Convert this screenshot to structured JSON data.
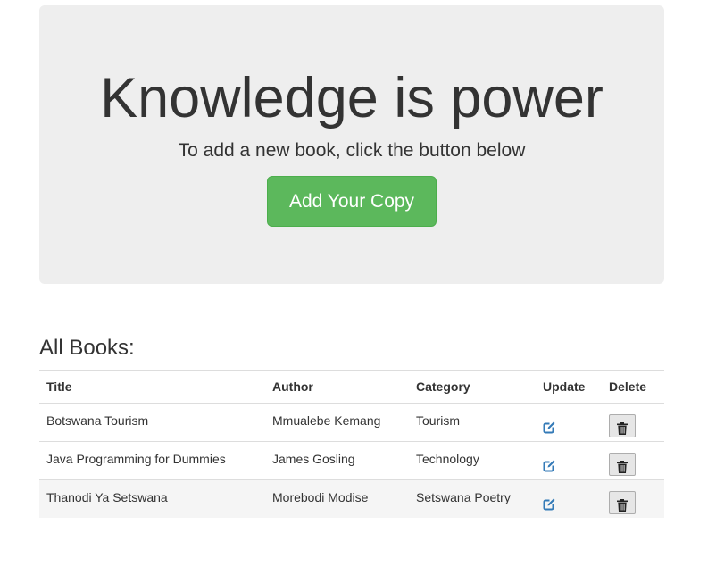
{
  "jumbotron": {
    "title": "Knowledge is power",
    "subtitle": "To add a new book, click the button below",
    "add_button_label": "Add Your Copy"
  },
  "books_section": {
    "title": "All Books:",
    "columns": [
      "Title",
      "Author",
      "Category",
      "Update",
      "Delete"
    ],
    "rows": [
      {
        "title": "Botswana Tourism",
        "author": "Mmualebe Kemang",
        "category": "Tourism"
      },
      {
        "title": "Java Programming for Dummies",
        "author": "James Gosling",
        "category": "Technology"
      },
      {
        "title": "Thanodi Ya Setswana",
        "author": "Morebodi Modise",
        "category": "Setswana Poetry"
      }
    ]
  },
  "icons": {
    "update": "edit-icon",
    "delete": "trash-icon"
  },
  "colors": {
    "jumbotron_bg": "#eeeeee",
    "add_button": "#5cb85c",
    "edit_icon": "#337ab7",
    "striped_row": "#f5f5f5"
  }
}
